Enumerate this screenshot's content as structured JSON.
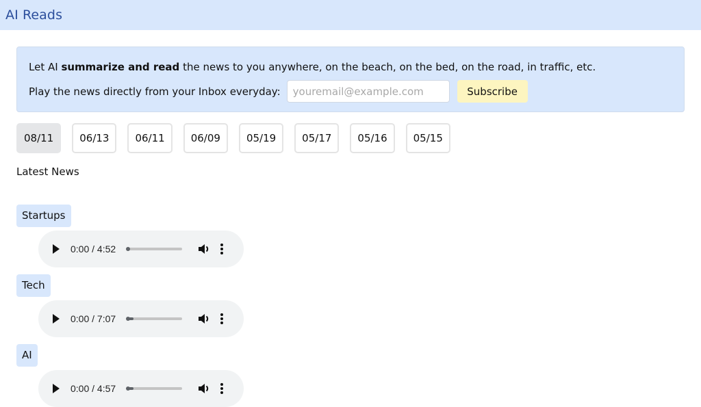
{
  "header": {
    "title": "AI Reads"
  },
  "banner": {
    "line1_prefix": "Let AI ",
    "line1_bold": "summarize and read",
    "line1_suffix": " the news to you anywhere, on the beach, on the bed, on the road, in traffic, etc.",
    "line2_label": "Play the news directly from your Inbox everyday:",
    "email_value": "",
    "email_placeholder": "youremail@example.com",
    "subscribe_label": "Subscribe"
  },
  "dates": [
    {
      "label": "08/11",
      "active": true
    },
    {
      "label": "06/13",
      "active": false
    },
    {
      "label": "06/11",
      "active": false
    },
    {
      "label": "06/09",
      "active": false
    },
    {
      "label": "05/19",
      "active": false
    },
    {
      "label": "05/17",
      "active": false
    },
    {
      "label": "05/16",
      "active": false
    },
    {
      "label": "05/15",
      "active": false
    }
  ],
  "latest_heading": "Latest News",
  "sections": [
    {
      "tag": "Startups",
      "player": {
        "current": "0:00",
        "duration": "4:52",
        "time_text": "0:00 / 4:52",
        "buffered": 0.0
      }
    },
    {
      "tag": "Tech",
      "player": {
        "current": "0:00",
        "duration": "7:07",
        "time_text": "0:00 / 7:07",
        "buffered": 0.12
      }
    },
    {
      "tag": "AI",
      "player": {
        "current": "0:00",
        "duration": "4:57",
        "time_text": "0:00 / 4:57",
        "buffered": 0.12
      }
    }
  ],
  "icons": {
    "play": "play-icon",
    "volume": "volume-icon",
    "more": "more-vertical-icon"
  }
}
